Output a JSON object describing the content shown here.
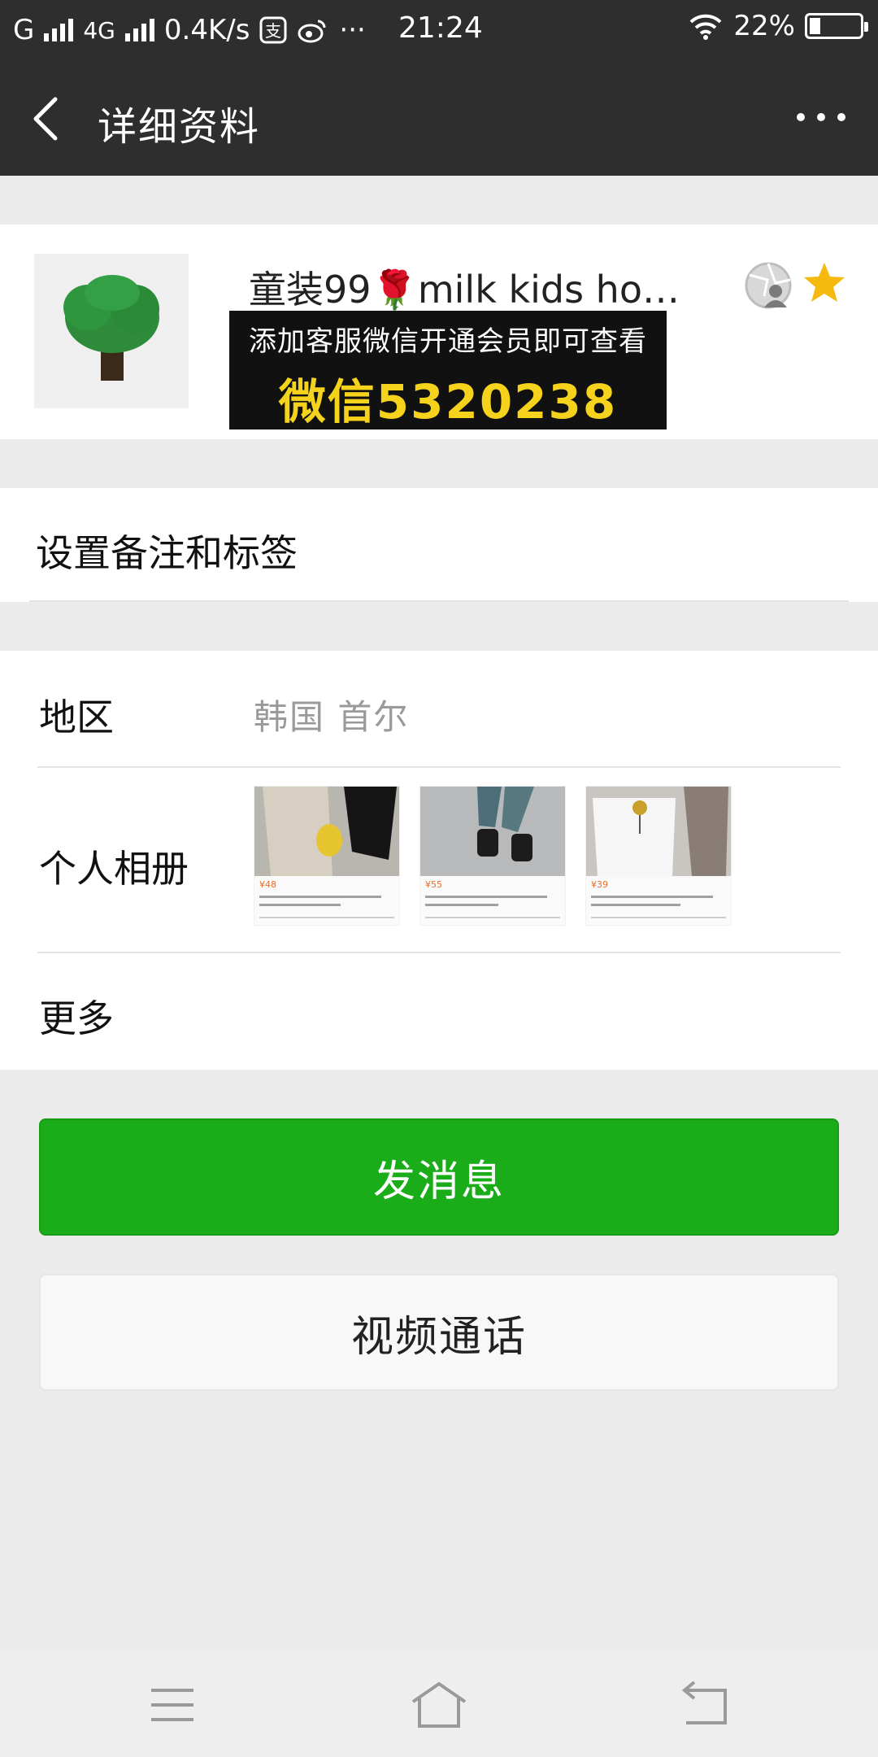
{
  "status_bar": {
    "carrier": "G",
    "network": "4G",
    "speed": "0.4K/s",
    "time": "21:24",
    "battery": "22%",
    "battery_level": 0.22,
    "icons": [
      "signal-icon",
      "alipay-icon",
      "weibo-icon",
      "more-dots-icon",
      "wifi-icon",
      "battery-icon"
    ]
  },
  "header": {
    "title": "详细资料",
    "back_icon": "chevron-left-icon",
    "more_icon": "more-horizontal-icon"
  },
  "profile": {
    "name_before": "童装99",
    "name_emoji": "🌹",
    "name_after": "milk kids ho…",
    "promo_line1": "添加客服微信开通会员即可查看",
    "promo_line2": "微信5320238",
    "avatar_icon": "tree-icon",
    "moments_icon": "aperture-icon",
    "star_icon": "star-icon",
    "star_color": "#f5b90f"
  },
  "remark": {
    "label": "设置备注和标签"
  },
  "info": {
    "region_label": "地区",
    "region_value": "韩国  首尔",
    "album_label": "个人相册",
    "album_thumbs": [
      {
        "price": "¥48"
      },
      {
        "price": "¥55"
      },
      {
        "price": "¥39"
      }
    ],
    "more_label": "更多"
  },
  "actions": {
    "send_message": "发消息",
    "video_call": "视频通话",
    "send_color": "#1aad19"
  },
  "navbar": {
    "icons": [
      "menu-icon",
      "home-icon",
      "back-icon"
    ]
  }
}
